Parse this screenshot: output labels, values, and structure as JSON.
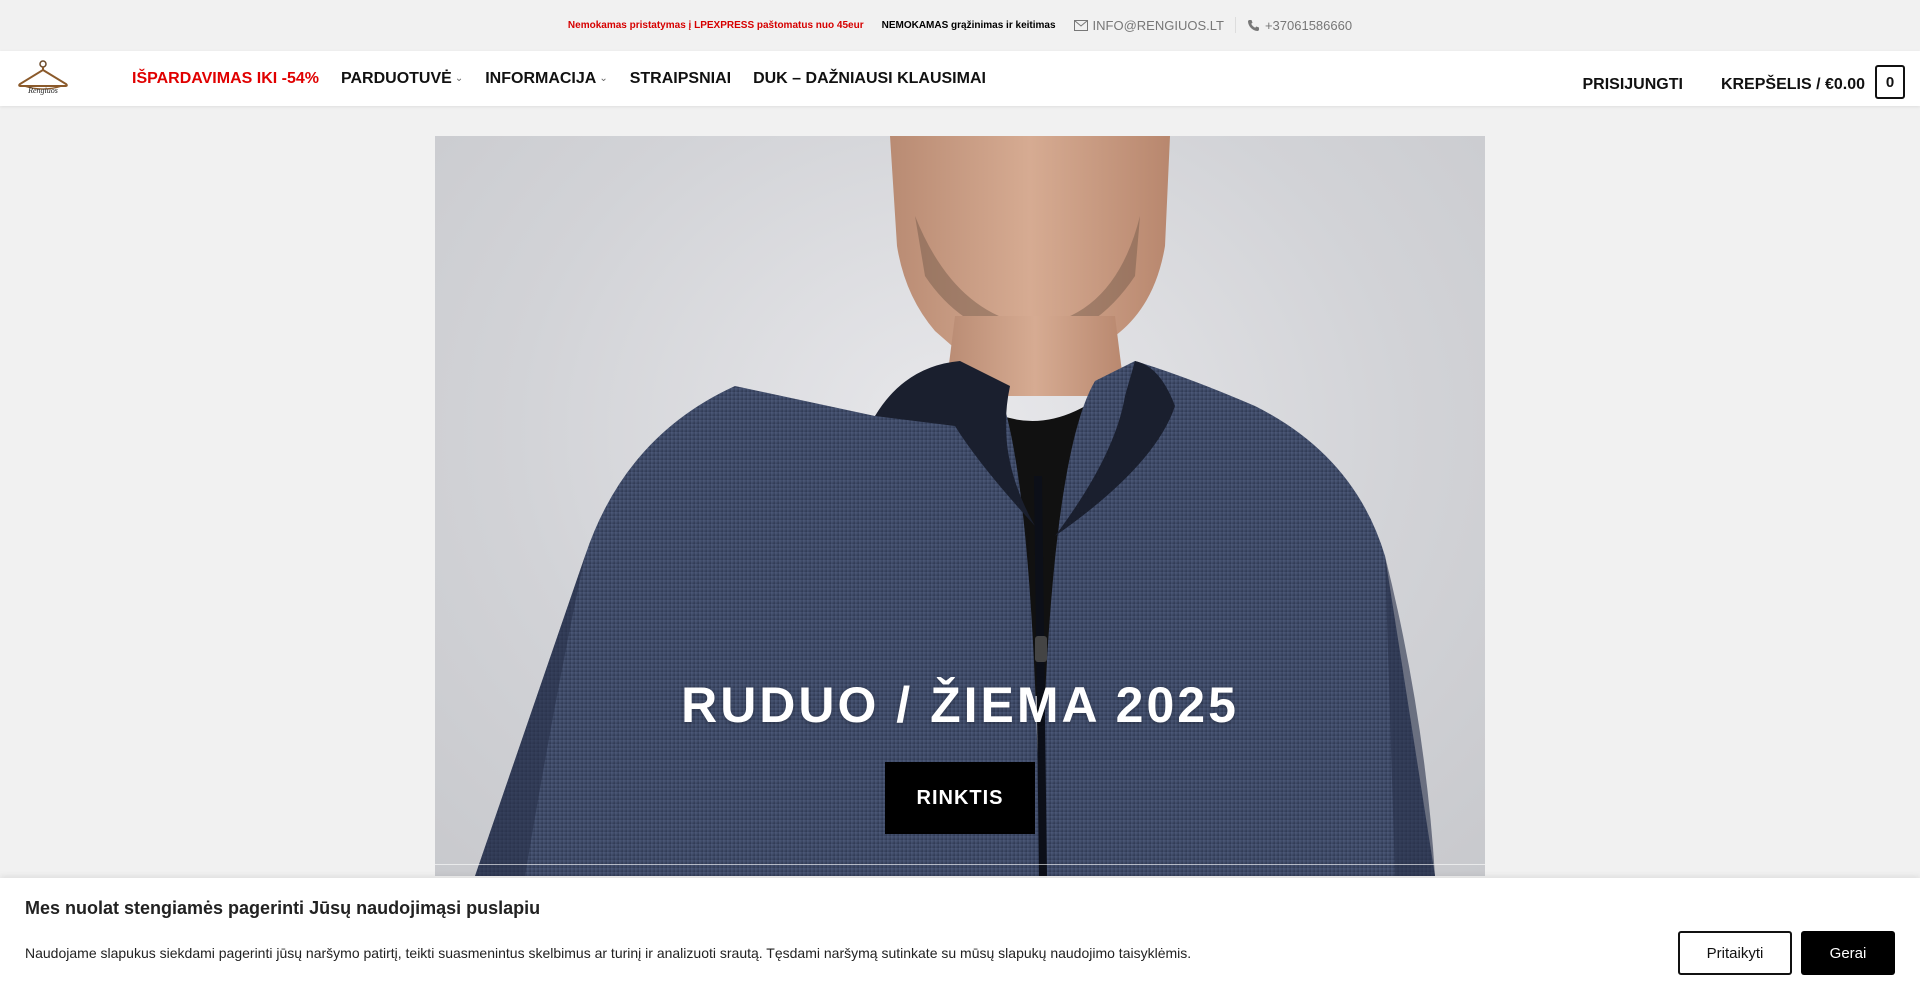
{
  "topbar": {
    "promo_delivery": "Nemokamas pristatymas į LPEXPRESS paštomatus nuo 45eur",
    "promo_returns": "NEMOKAMAS grąžinimas ir keitimas",
    "email": "INFO@RENGIUOS.LT",
    "phone": "+37061586660"
  },
  "header": {
    "logo_text": "Rengiuos",
    "nav": [
      {
        "label": "IŠPARDAVIMAS IKI -54%"
      },
      {
        "label": "PARDUOTUVĖ"
      },
      {
        "label": "INFORMACIJA"
      },
      {
        "label": "STRAIPSNIAI"
      },
      {
        "label": "DUK – DAŽNIAUSI KLAUSIMAI"
      }
    ],
    "login": "PRISIJUNGTI",
    "cart_label": "KREPŠELIS / €0.00",
    "cart_count": "0"
  },
  "hero": {
    "title": "RUDUO / ŽIEMA 2025",
    "button": "RINKTIS"
  },
  "cookie": {
    "title": "Mes nuolat stengiamės pagerinti Jūsų naudojimąsi puslapiu",
    "text": "Naudojame slapukus siekdami pagerinti jūsų naršymo patirtį, teikti suasmenintus skelbimus ar turinį ir analizuoti srautą. Tęsdami naršymą sutinkate su mūsų slapukų naudojimo taisyklėmis.",
    "customize_button": "Pritaikyti",
    "accept_button": "Gerai"
  },
  "colors": {
    "sale_red": "#e00000",
    "promo_red": "#d60000",
    "sweater_navy": "#3d4a66"
  }
}
